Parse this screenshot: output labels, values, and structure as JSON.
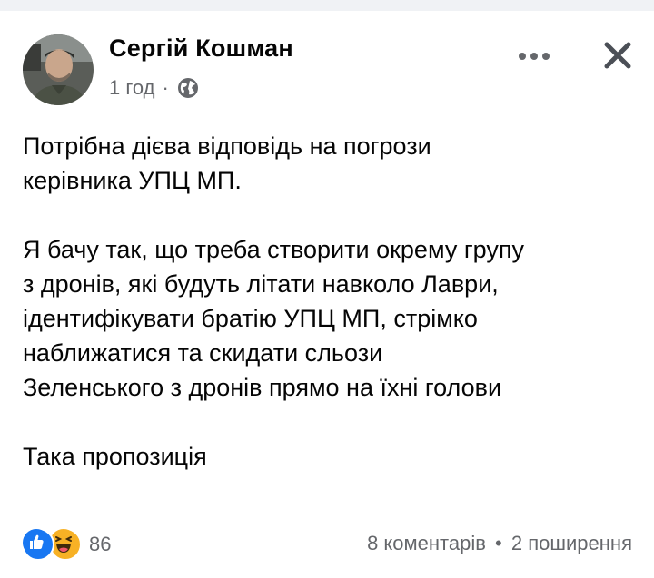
{
  "post": {
    "author": "Сергій Кошман",
    "time": "1 год",
    "separator": "·",
    "privacy_icon": "globe-icon",
    "text_lines": [
      "Потрібна дієва відповідь на погрози",
      "керівника УПЦ МП.",
      "",
      "Я бачу так, що треба створити окрему групу",
      "з дронів, які будуть літати навколо Лаври,",
      "ідентифікувати братію УПЦ МП, стрімко",
      "наближатися та скидати сльози",
      "Зеленського з дронів прямо на їхні голови",
      "",
      "Така пропозиція"
    ]
  },
  "stats": {
    "reaction_icons": [
      "like-icon",
      "haha-icon"
    ],
    "reaction_count": "86",
    "comments": "8 коментарів",
    "dot": "•",
    "shares": "2 поширення"
  },
  "colors": {
    "secondary_text": "#65676b",
    "like_blue": "#1877f2",
    "haha_yellow": "#f7b125",
    "top_bar": "#f0f2f5"
  }
}
